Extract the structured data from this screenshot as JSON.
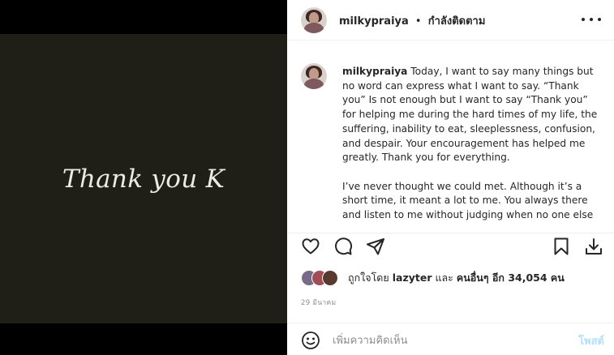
{
  "media": {
    "overlay_text": "Thank you K",
    "background": "#1f1e17"
  },
  "header": {
    "username": "milkypraiya",
    "separator": "•",
    "follow_status": "กำลังติดตาม",
    "more_icon": "more-horizontal-icon"
  },
  "caption": {
    "username": "milkypraiya",
    "paragraph1": "Today, I want to say many things but no word can express what I want to say. “Thank you” Is not enough but I want to say “Thank you” for helping me during the hard times of my life, the suffering, inability to eat, sleeplessness, confusion, and despair. Your encouragement has helped me greatly. Thank you for everything.",
    "paragraph2": "I’ve never thought we could met. Although it’s a short time, it meant a lot to me. You always there and listen to me without judging when no one else"
  },
  "actions": {
    "like_icon": "heart-icon",
    "comment_icon": "comment-bubble-icon",
    "share_icon": "paper-plane-icon",
    "save_icon": "bookmark-icon",
    "download_icon": "download-icon"
  },
  "likes": {
    "prefix": "ถูกใจโดย",
    "liked_user": "lazyter",
    "connector": "และ",
    "others": "คนอื่นๆ อีก 34,054 คน",
    "avatar_colors": [
      "#7a6a8a",
      "#a14d55",
      "#5a3a2e"
    ]
  },
  "post_date": "29 มีนาคม",
  "comment": {
    "emoji_icon": "smiley-icon",
    "placeholder": "เพิ่มความคิดเห็น",
    "post_label": "โพสต์"
  },
  "colors": {
    "accent_disabled": "#b2dffc",
    "text": "#262626",
    "muted": "#8e8e8e"
  }
}
